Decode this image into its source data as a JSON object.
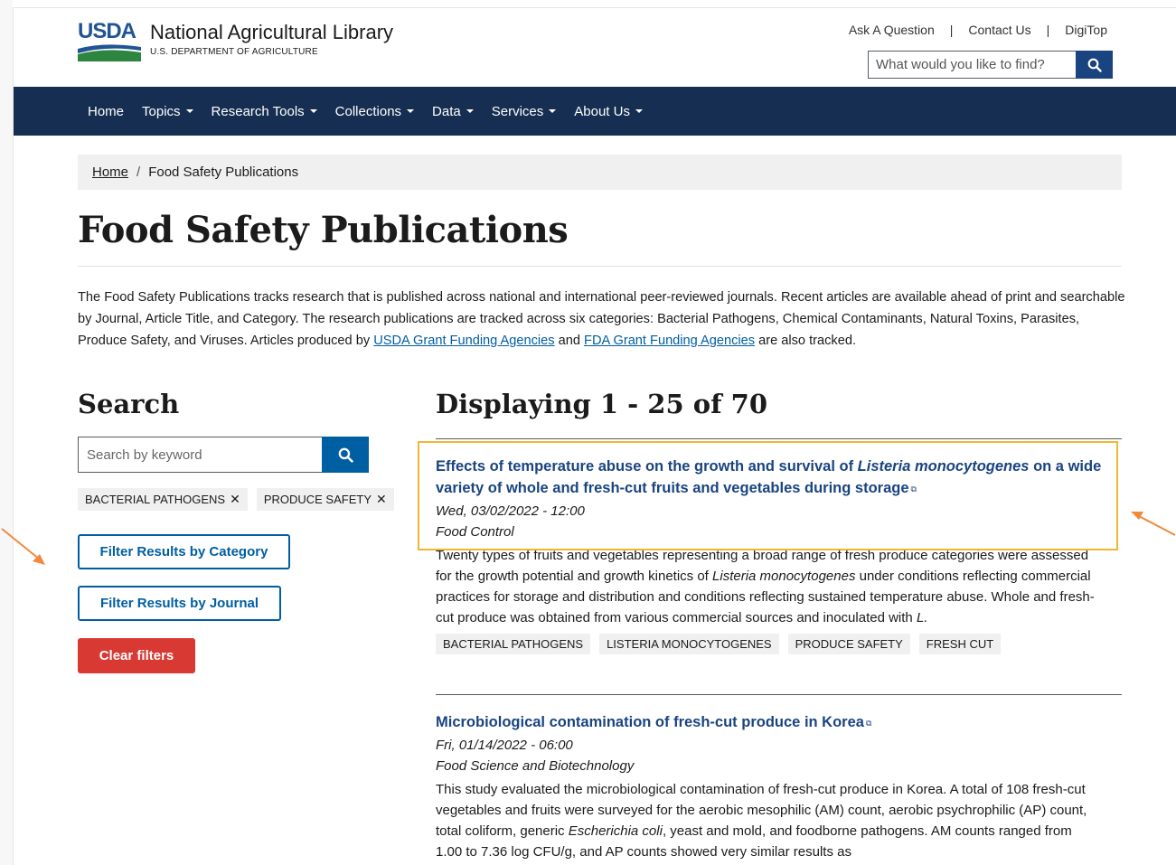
{
  "header": {
    "logo_text": "USDA",
    "org_name": "National Agricultural Library",
    "org_sub": "U.S. DEPARTMENT OF AGRICULTURE",
    "util_links": [
      "Ask A Question",
      "Contact Us",
      "DigiTop"
    ],
    "search_placeholder": "What would you like to find?"
  },
  "nav": {
    "items": [
      {
        "label": "Home",
        "dropdown": false
      },
      {
        "label": "Topics",
        "dropdown": true
      },
      {
        "label": "Research Tools",
        "dropdown": true
      },
      {
        "label": "Collections",
        "dropdown": true
      },
      {
        "label": "Data",
        "dropdown": true
      },
      {
        "label": "Services",
        "dropdown": true
      },
      {
        "label": "About Us",
        "dropdown": true
      }
    ]
  },
  "breadcrumb": {
    "home": "Home",
    "separator": "/",
    "current": "Food Safety Publications"
  },
  "page": {
    "title": "Food Safety Publications",
    "intro_part1": "The Food Safety Publications tracks research that is published across national and international peer-reviewed journals. Recent articles are available ahead of print and searchable by Journal, Article Title, and Category. The research publications are tracked across six categories: Bacterial Pathogens, Chemical Contaminants, Natural Toxins, Parasites, Produce Safety, and Viruses. Articles produced by ",
    "intro_link1": "USDA Grant Funding Agencies",
    "intro_and": " and ",
    "intro_link2": "FDA Grant Funding Agencies",
    "intro_end": " are also tracked."
  },
  "sidebar": {
    "heading": "Search",
    "search_placeholder": "Search by keyword",
    "active_filters": [
      "BACTERIAL PATHOGENS",
      "PRODUCE SAFETY"
    ],
    "filter_category_label": "Filter Results by Category",
    "filter_journal_label": "Filter Results by Journal",
    "clear_label": "Clear filters"
  },
  "results": {
    "heading": "Displaying 1 - 25 of 70",
    "items": [
      {
        "title_pre": "Effects of temperature abuse on the growth and survival of ",
        "title_italic": "Listeria monocytogenes",
        "title_post": " on a wide variety of whole and fresh-cut fruits and vegetables during storage",
        "date": "Wed, 03/02/2022 - 12:00",
        "journal": "Food Control",
        "abstract_pre": "Twenty types of fruits and vegetables representing a broad range of fresh produce categories were assessed for the growth potential and growth kinetics of ",
        "abstract_italic": "Listeria monocytogenes",
        "abstract_mid": " under conditions reflecting commercial practices for storage and distribution and conditions reflecting sustained temperature abuse. Whole and fresh-cut produce was obtained from various commercial sources and inoculated with ",
        "abstract_italic2": "L.",
        "tags": [
          "BACTERIAL PATHOGENS",
          "LISTERIA MONOCYTOGENES",
          "PRODUCE SAFETY",
          "FRESH CUT"
        ]
      },
      {
        "title": "Microbiological contamination of fresh-cut produce in Korea",
        "date": "Fri, 01/14/2022 - 06:00",
        "journal": "Food Science and Biotechnology",
        "abstract_pre": "This study evaluated the microbiological contamination of fresh-cut produce in Korea. A total of 108 fresh-cut vegetables and fruits were surveyed for the aerobic mesophilic (AM) count, aerobic psychrophilic (AP) count, total coliform, generic ",
        "abstract_italic": "Escherichia coli",
        "abstract_post": ", yeast and mold, and foodborne pathogens. AM counts ranged from 1.00 to 7.36 log CFU/g, and AP counts showed very similar results as"
      }
    ]
  },
  "colors": {
    "navbar": "#162e51",
    "link": "#1a4480",
    "primary_button": "#005ea2",
    "clear_button": "#d83933",
    "highlight": "#f2b632",
    "annotation_arrow": "#f08a3c"
  }
}
